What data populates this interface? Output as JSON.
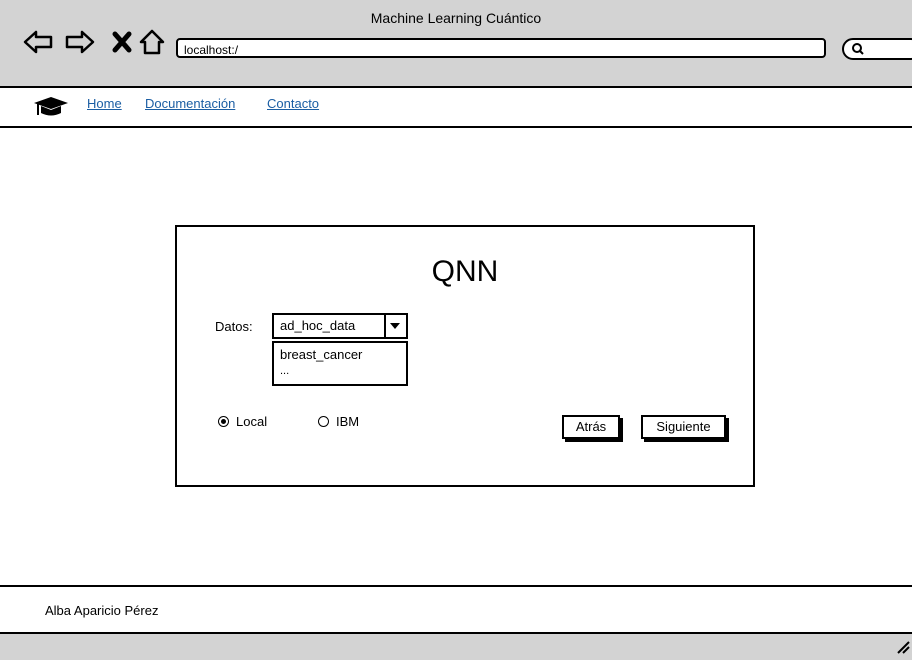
{
  "window": {
    "title": "Machine Learning Cuántico"
  },
  "browser": {
    "url": "localhost:/"
  },
  "nav": {
    "links": [
      "Home",
      "Documentación",
      "Contacto"
    ]
  },
  "dialog": {
    "title": "QNN",
    "datos_label": "Datos:",
    "select_value": "ad_hoc_data",
    "options": [
      "breast_cancer",
      "..."
    ],
    "radios": [
      {
        "label": "Local",
        "selected": true
      },
      {
        "label": "IBM",
        "selected": false
      }
    ],
    "back_label": "Atrás",
    "next_label": "Siguiente"
  },
  "footer": {
    "author": "Alba Aparicio Pérez"
  }
}
